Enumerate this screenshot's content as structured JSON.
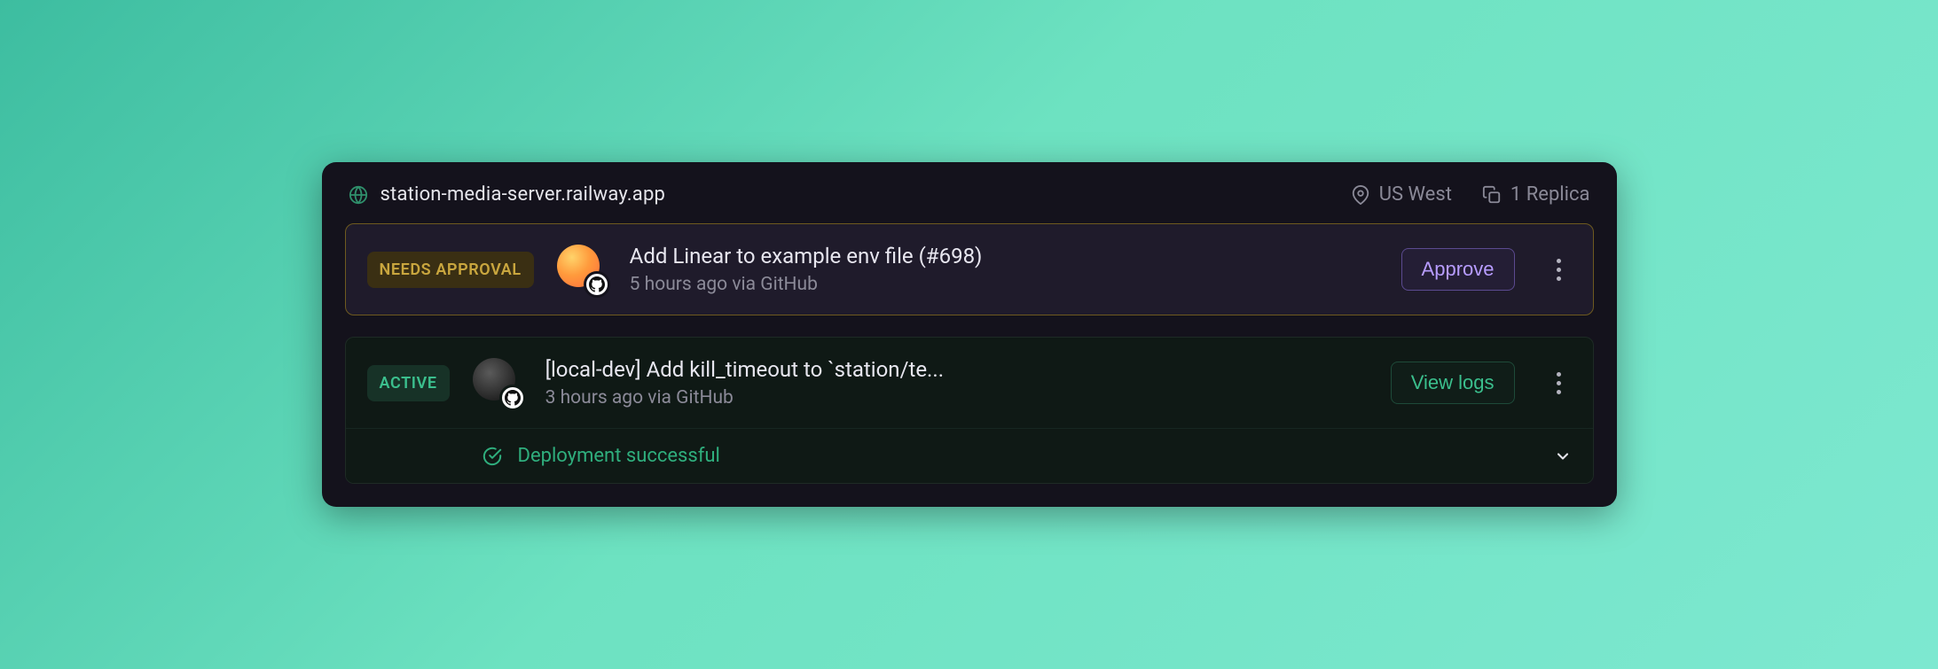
{
  "header": {
    "domain": "station-media-server.railway.app",
    "region": "US West",
    "replicas": "1 Replica"
  },
  "deployments": [
    {
      "badge": "NEEDS APPROVAL",
      "title": "Add Linear to example env file (#698)",
      "subtitle": "5 hours ago via GitHub",
      "action": "Approve"
    },
    {
      "badge": "ACTIVE",
      "title": "[local-dev] Add kill_timeout to `station/te...",
      "subtitle": "3 hours ago via GitHub",
      "action": "View logs",
      "status": "Deployment successful"
    }
  ]
}
